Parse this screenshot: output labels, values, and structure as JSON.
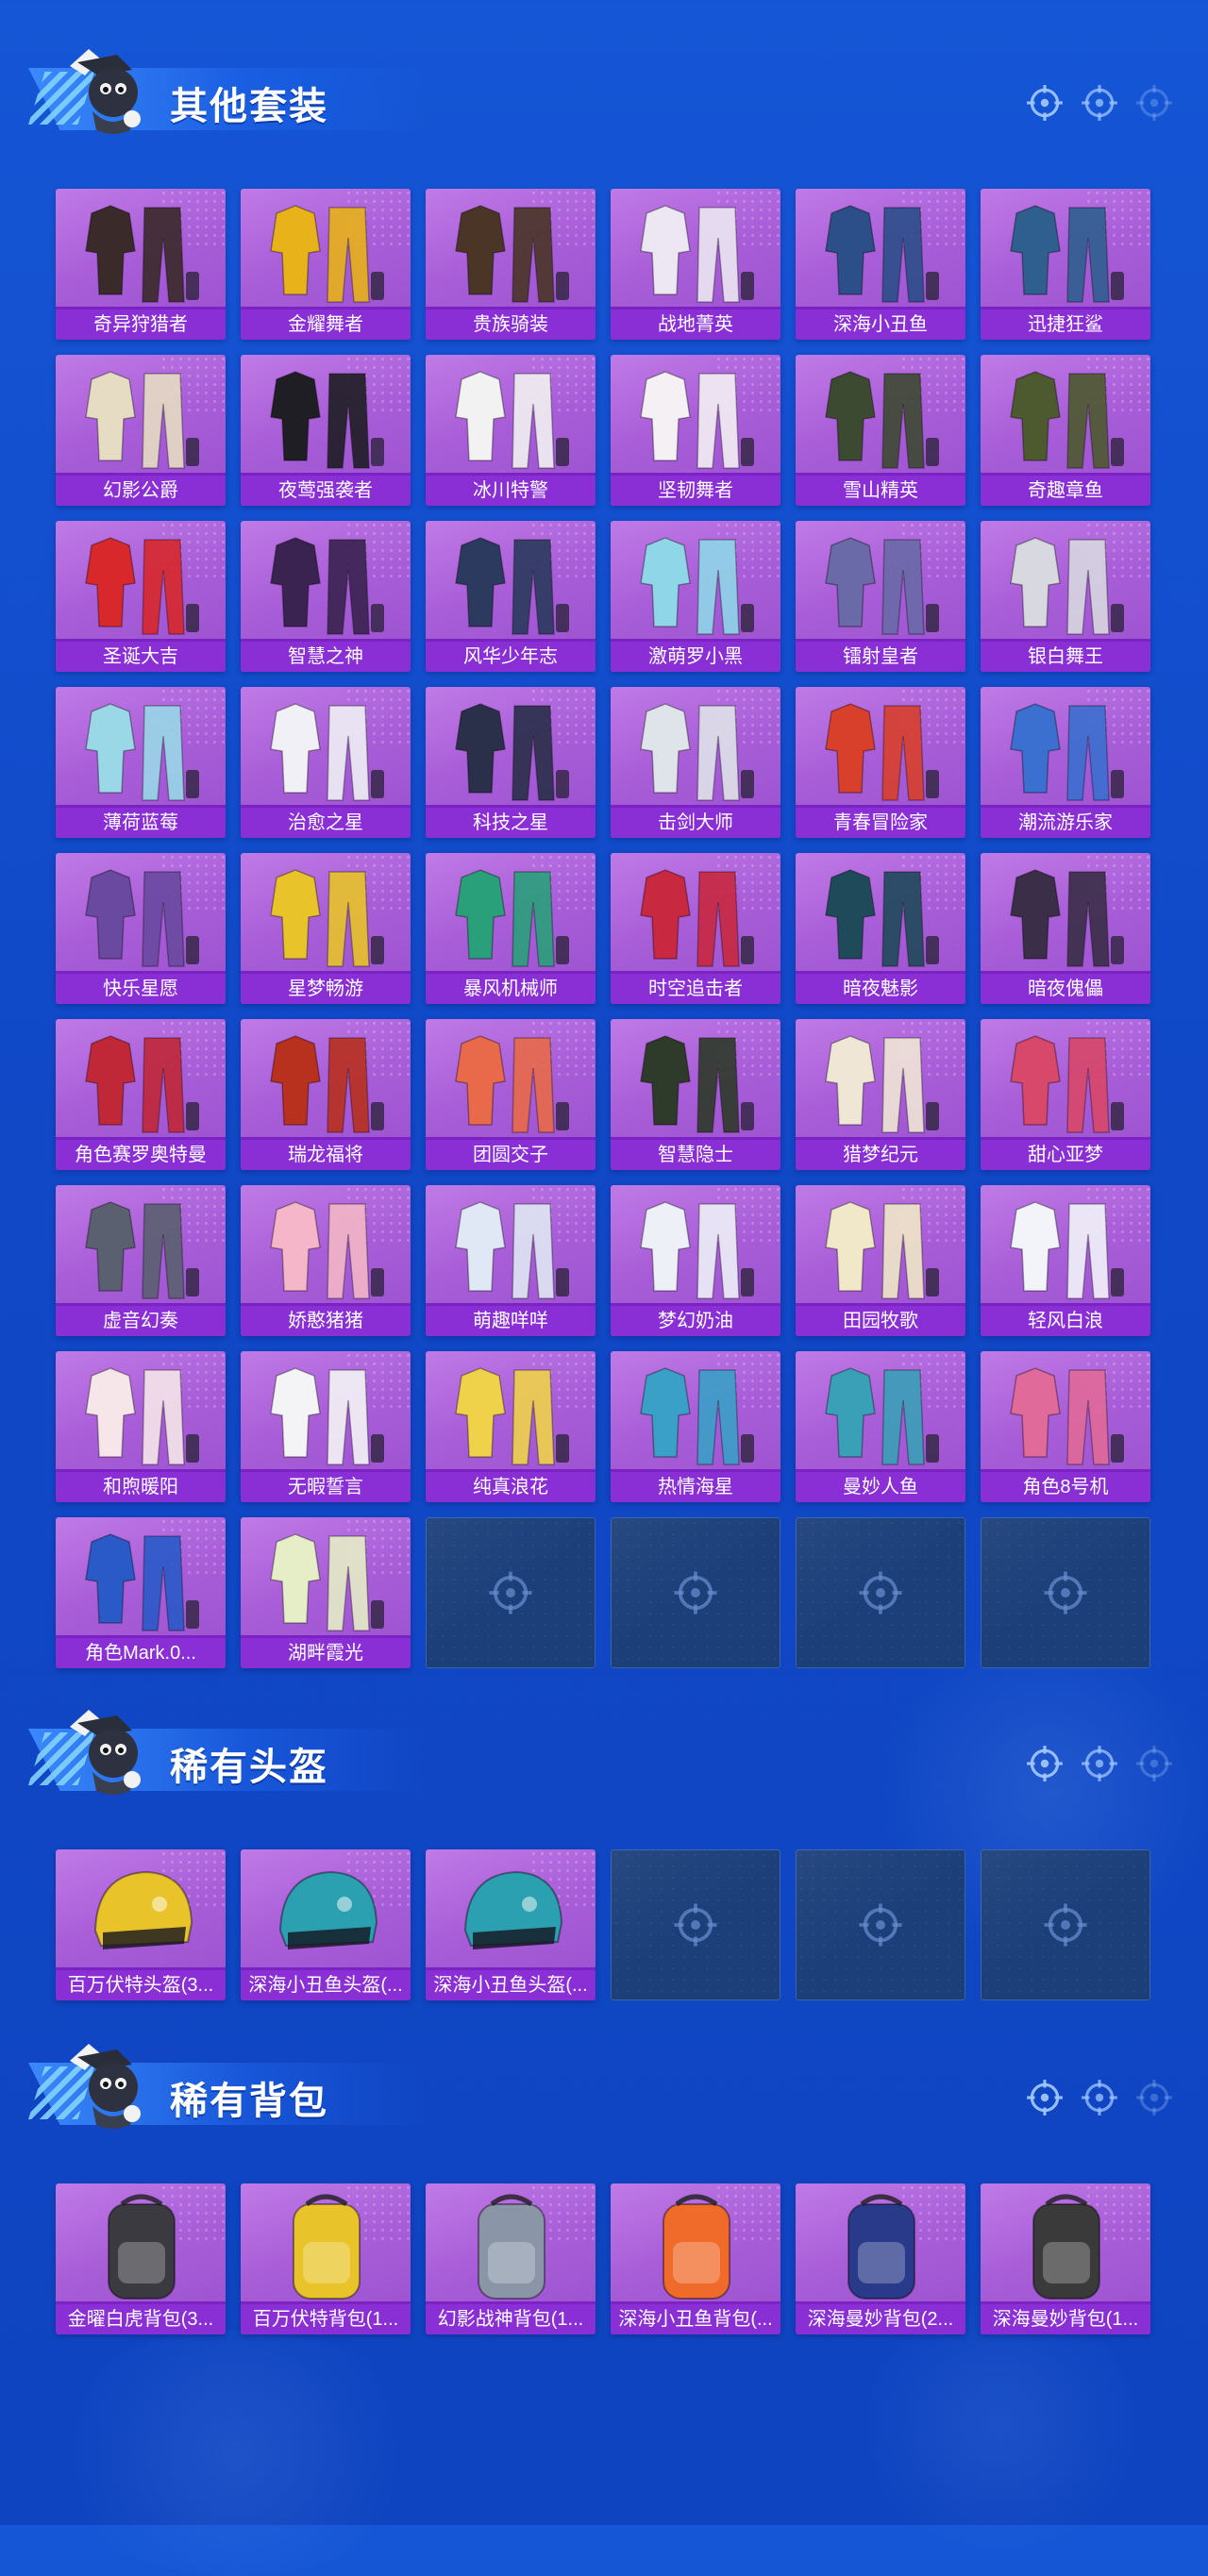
{
  "colors": {
    "background": "#1352d2",
    "card_purple": "#a95ed8",
    "label_purple": "#8a2fd6",
    "empty_slot": "#1c3f7a",
    "title_text": "#ffffff"
  },
  "sections": [
    {
      "title": "其他套装",
      "icon": "mascot-icon",
      "items": [
        {
          "label": "奇异狩猎者",
          "kind": "outfit",
          "color": "#3a2a2a"
        },
        {
          "label": "金耀舞者",
          "kind": "outfit",
          "color": "#e8b21a"
        },
        {
          "label": "贵族骑装",
          "kind": "outfit",
          "color": "#4a3526"
        },
        {
          "label": "战地菁英",
          "kind": "outfit",
          "color": "#ece7f2"
        },
        {
          "label": "深海小丑鱼",
          "kind": "outfit",
          "color": "#2c4f8a"
        },
        {
          "label": "迅捷狂鲨",
          "kind": "outfit",
          "color": "#2f5f8f"
        },
        {
          "label": "幻影公爵",
          "kind": "outfit",
          "color": "#e6dcc4"
        },
        {
          "label": "夜莺强袭者",
          "kind": "outfit",
          "color": "#1e1e24"
        },
        {
          "label": "冰川特警",
          "kind": "outfit",
          "color": "#f2f2f2"
        },
        {
          "label": "坚韧舞者",
          "kind": "outfit",
          "color": "#f4f0f4"
        },
        {
          "label": "雪山精英",
          "kind": "outfit",
          "color": "#3d4a32"
        },
        {
          "label": "奇趣章鱼",
          "kind": "outfit",
          "color": "#4d5a2f"
        },
        {
          "label": "圣诞大吉",
          "kind": "outfit",
          "color": "#d8282c"
        },
        {
          "label": "智慧之神",
          "kind": "outfit",
          "color": "#3a2350"
        },
        {
          "label": "风华少年志",
          "kind": "outfit",
          "color": "#2b3a5e"
        },
        {
          "label": "激萌罗小黑",
          "kind": "outfit",
          "color": "#8fd6e8"
        },
        {
          "label": "镭射皇者",
          "kind": "outfit",
          "color": "#6a6aa8"
        },
        {
          "label": "银白舞王",
          "kind": "outfit",
          "color": "#d8d8e0"
        },
        {
          "label": "薄荷蓝莓",
          "kind": "outfit",
          "color": "#9ad8e8"
        },
        {
          "label": "治愈之星",
          "kind": "outfit",
          "color": "#f0f0f6"
        },
        {
          "label": "科技之星",
          "kind": "outfit",
          "color": "#2a2f4a"
        },
        {
          "label": "击剑大师",
          "kind": "outfit",
          "color": "#dfe3ea"
        },
        {
          "label": "青春冒险家",
          "kind": "outfit",
          "color": "#d8402c"
        },
        {
          "label": "潮流游乐家",
          "kind": "outfit",
          "color": "#3b6fd0"
        },
        {
          "label": "快乐星愿",
          "kind": "outfit",
          "color": "#6a4aa0"
        },
        {
          "label": "星梦畅游",
          "kind": "outfit",
          "color": "#e8c42a"
        },
        {
          "label": "暴风机械师",
          "kind": "outfit",
          "color": "#2aa07a"
        },
        {
          "label": "时空追击者",
          "kind": "outfit",
          "color": "#c82840"
        },
        {
          "label": "暗夜魅影",
          "kind": "outfit",
          "color": "#1f4a5a"
        },
        {
          "label": "暗夜傀儡",
          "kind": "outfit",
          "color": "#3a2e48"
        },
        {
          "label": "角色赛罗奥特曼",
          "kind": "outfit",
          "color": "#c02838"
        },
        {
          "label": "瑞龙福将",
          "kind": "outfit",
          "color": "#b8301e"
        },
        {
          "label": "团圆交子",
          "kind": "outfit",
          "color": "#e86a4a"
        },
        {
          "label": "智慧隐士",
          "kind": "outfit",
          "color": "#2e3a2a"
        },
        {
          "label": "猎梦纪元",
          "kind": "outfit",
          "color": "#f0e6d6"
        },
        {
          "label": "甜心亚梦",
          "kind": "outfit",
          "color": "#d8486a"
        },
        {
          "label": "虚音幻奏",
          "kind": "outfit",
          "color": "#5a6070"
        },
        {
          "label": "娇憨猪猪",
          "kind": "outfit",
          "color": "#f4b6c8"
        },
        {
          "label": "萌趣咩咩",
          "kind": "outfit",
          "color": "#dfe8f4"
        },
        {
          "label": "梦幻奶油",
          "kind": "outfit",
          "color": "#eef0f8"
        },
        {
          "label": "田园牧歌",
          "kind": "outfit",
          "color": "#f0e8c8"
        },
        {
          "label": "轻风白浪",
          "kind": "outfit",
          "color": "#f2f4fa"
        },
        {
          "label": "和煦暖阳",
          "kind": "outfit",
          "color": "#f6e6ea"
        },
        {
          "label": "无暇誓言",
          "kind": "outfit",
          "color": "#f4f4f6"
        },
        {
          "label": "纯真浪花",
          "kind": "outfit",
          "color": "#f0d24a"
        },
        {
          "label": "热情海星",
          "kind": "outfit",
          "color": "#3aa0c8"
        },
        {
          "label": "曼妙人鱼",
          "kind": "outfit",
          "color": "#3aa0b8"
        },
        {
          "label": "角色8号机",
          "kind": "outfit",
          "color": "#e06a9a"
        },
        {
          "label": "角色Mark.0...",
          "kind": "outfit",
          "color": "#2a5ac8"
        },
        {
          "label": "湖畔霞光",
          "kind": "outfit",
          "color": "#e6eec8"
        },
        {
          "label": "",
          "kind": "empty"
        },
        {
          "label": "",
          "kind": "empty"
        },
        {
          "label": "",
          "kind": "empty"
        },
        {
          "label": "",
          "kind": "empty"
        }
      ]
    },
    {
      "title": "稀有头盔",
      "icon": "mascot-icon",
      "items": [
        {
          "label": "百万伏特头盔(3...",
          "kind": "helmet",
          "color": "#e8c42a"
        },
        {
          "label": "深海小丑鱼头盔(...",
          "kind": "helmet",
          "color": "#2aa0b0"
        },
        {
          "label": "深海小丑鱼头盔(...",
          "kind": "helmet",
          "color": "#2aa0b0"
        },
        {
          "label": "",
          "kind": "empty"
        },
        {
          "label": "",
          "kind": "empty"
        },
        {
          "label": "",
          "kind": "empty"
        }
      ]
    },
    {
      "title": "稀有背包",
      "icon": "mascot-icon",
      "items": [
        {
          "label": "金曜白虎背包(3...",
          "kind": "backpack",
          "color": "#3a3a40"
        },
        {
          "label": "百万伏特背包(1...",
          "kind": "backpack",
          "color": "#e8c42a"
        },
        {
          "label": "幻影战神背包(1...",
          "kind": "backpack",
          "color": "#8a96a8"
        },
        {
          "label": "深海小丑鱼背包(...",
          "kind": "backpack",
          "color": "#f06a2a"
        },
        {
          "label": "深海曼妙背包(2...",
          "kind": "backpack",
          "color": "#2a3a8a"
        },
        {
          "label": "深海曼妙背包(1...",
          "kind": "backpack",
          "color": "#3a3a3a"
        }
      ]
    }
  ]
}
